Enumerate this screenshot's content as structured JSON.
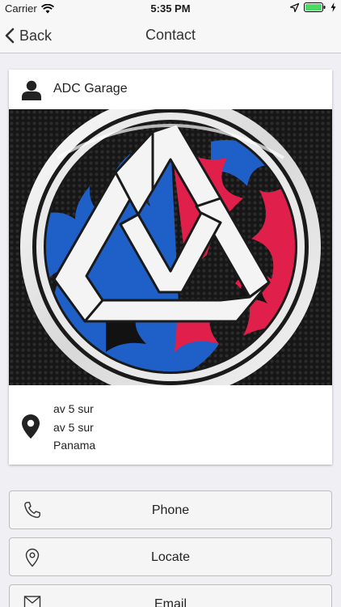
{
  "status_bar": {
    "carrier": "Carrier",
    "time": "5:35 PM"
  },
  "nav": {
    "back_label": "Back",
    "title": "Contact"
  },
  "contact": {
    "name": "ADC Garage",
    "address_lines": [
      "av 5 sur",
      "av 5 sur",
      "Panama"
    ]
  },
  "actions": [
    {
      "label": "Phone",
      "icon": "phone-icon"
    },
    {
      "label": "Locate",
      "icon": "location-pin-icon"
    },
    {
      "label": "Email",
      "icon": "envelope-icon"
    }
  ],
  "colors": {
    "accent_blue": "#1f5fc8",
    "accent_red": "#e0204a",
    "battery_green": "#4cd964"
  }
}
